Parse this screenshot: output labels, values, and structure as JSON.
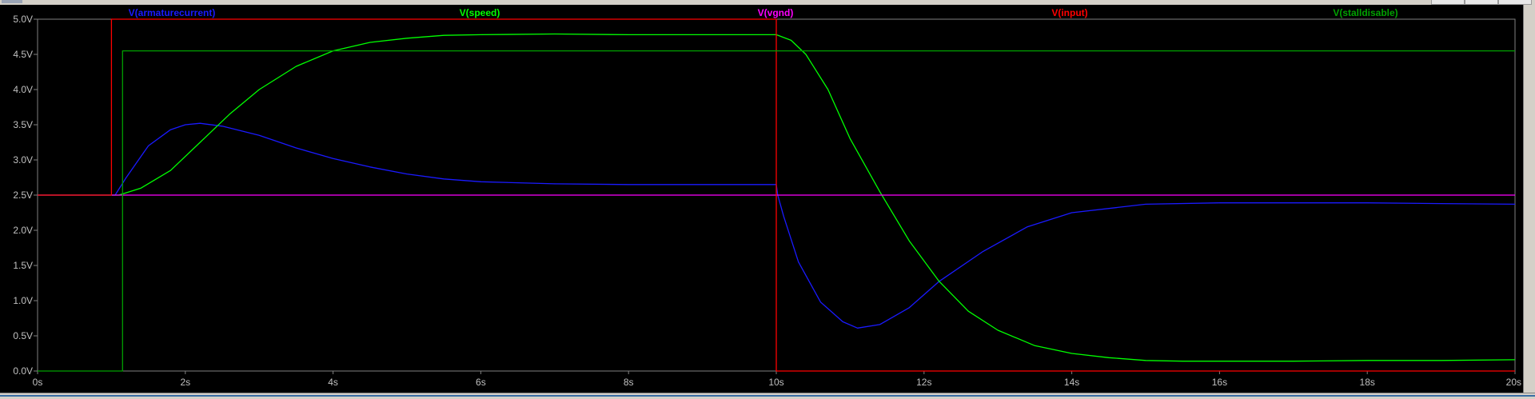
{
  "chart_data": {
    "type": "line",
    "background": "#000000",
    "grid": false,
    "axis_color": "#808080",
    "tick_color": "#c0c0c0",
    "xlim": [
      0,
      20
    ],
    "ylim": [
      0,
      5
    ],
    "x_ticks": [
      {
        "value": 0,
        "label": "0s"
      },
      {
        "value": 2,
        "label": "2s"
      },
      {
        "value": 4,
        "label": "4s"
      },
      {
        "value": 6,
        "label": "6s"
      },
      {
        "value": 8,
        "label": "8s"
      },
      {
        "value": 10,
        "label": "10s"
      },
      {
        "value": 12,
        "label": "12s"
      },
      {
        "value": 14,
        "label": "14s"
      },
      {
        "value": 16,
        "label": "16s"
      },
      {
        "value": 18,
        "label": "18s"
      },
      {
        "value": 20,
        "label": "20s"
      }
    ],
    "y_ticks": [
      {
        "value": 0,
        "label": "0.0V"
      },
      {
        "value": 0.5,
        "label": "0.5V"
      },
      {
        "value": 1.0,
        "label": "1.0V"
      },
      {
        "value": 1.5,
        "label": "1.5V"
      },
      {
        "value": 2.0,
        "label": "2.0V"
      },
      {
        "value": 2.5,
        "label": "2.5V"
      },
      {
        "value": 3.0,
        "label": "3.0V"
      },
      {
        "value": 3.5,
        "label": "3.5V"
      },
      {
        "value": 4.0,
        "label": "4.0V"
      },
      {
        "value": 4.5,
        "label": "4.5V"
      },
      {
        "value": 5.0,
        "label": "5.0V"
      }
    ],
    "legend_position": "top",
    "series": [
      {
        "name": "V(armaturecurrent)",
        "color": "#1a1aff",
        "x": [
          0,
          1.0,
          1.05,
          1.2,
          1.5,
          1.8,
          2.0,
          2.2,
          2.5,
          3.0,
          3.5,
          4.0,
          4.5,
          5.0,
          5.5,
          6.0,
          7.0,
          8.0,
          9.0,
          10.0,
          10.02,
          10.1,
          10.3,
          10.6,
          10.9,
          11.1,
          11.4,
          11.8,
          12.2,
          12.8,
          13.4,
          14.0,
          15.0,
          16.0,
          17.0,
          18.0,
          19.0,
          20.0
        ],
        "y": [
          2.5,
          2.5,
          2.5,
          2.75,
          3.2,
          3.43,
          3.5,
          3.52,
          3.48,
          3.35,
          3.17,
          3.02,
          2.9,
          2.8,
          2.73,
          2.69,
          2.66,
          2.65,
          2.65,
          2.65,
          2.5,
          2.2,
          1.55,
          0.98,
          0.7,
          0.61,
          0.66,
          0.9,
          1.27,
          1.7,
          2.05,
          2.25,
          2.37,
          2.39,
          2.39,
          2.39,
          2.38,
          2.37
        ]
      },
      {
        "name": "V(speed)",
        "color": "#00ff00",
        "x": [
          0,
          1.0,
          1.1,
          1.4,
          1.8,
          2.2,
          2.6,
          3.0,
          3.5,
          4.0,
          4.5,
          5.0,
          5.5,
          6.0,
          7.0,
          8.0,
          9.0,
          10.0,
          10.2,
          10.4,
          10.7,
          11.0,
          11.4,
          11.8,
          12.2,
          12.6,
          13.0,
          13.5,
          14.0,
          14.5,
          15.0,
          15.5,
          16.0,
          17.0,
          18.0,
          19.0,
          20.0
        ],
        "y": [
          2.5,
          2.5,
          2.5,
          2.6,
          2.85,
          3.25,
          3.65,
          4.0,
          4.33,
          4.55,
          4.67,
          4.73,
          4.77,
          4.78,
          4.79,
          4.78,
          4.78,
          4.78,
          4.7,
          4.5,
          4.0,
          3.3,
          2.55,
          1.85,
          1.28,
          0.85,
          0.58,
          0.36,
          0.25,
          0.19,
          0.15,
          0.14,
          0.14,
          0.14,
          0.15,
          0.15,
          0.16
        ]
      },
      {
        "name": "V(vgnd)",
        "color": "#ff00ff",
        "x": [
          0,
          20
        ],
        "y": [
          2.5,
          2.5
        ]
      },
      {
        "name": "V(input)",
        "color": "#ff0000",
        "x": [
          0,
          1.0,
          1.0,
          10.0,
          10.0,
          20.0
        ],
        "y": [
          2.5,
          2.5,
          5.0,
          5.0,
          0.0,
          0.0
        ]
      },
      {
        "name": "V(stalldisable)",
        "color": "#00a000",
        "x": [
          0,
          1.15,
          1.15,
          20.0
        ],
        "y": [
          0.0,
          0.0,
          4.55,
          4.55
        ]
      }
    ]
  }
}
